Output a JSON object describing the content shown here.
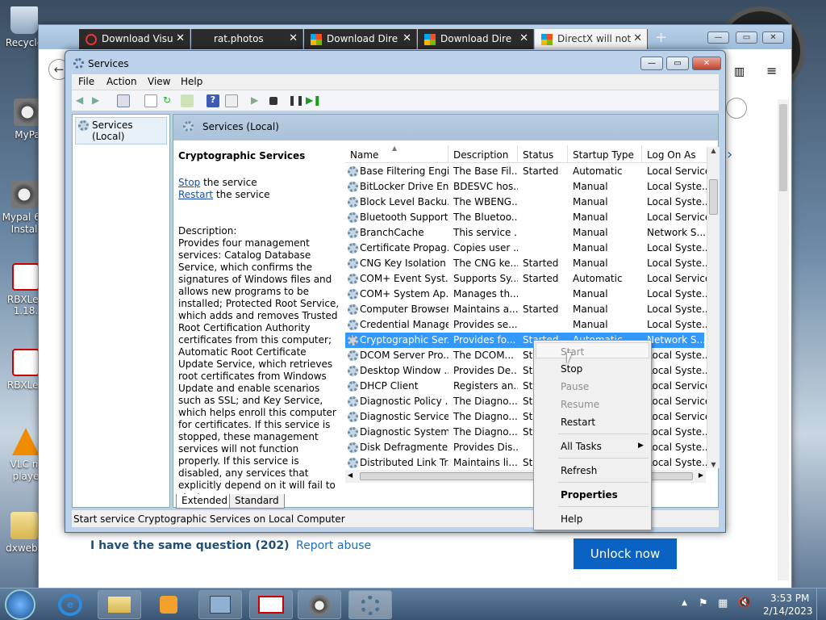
{
  "desktop": {
    "icons": [
      {
        "label": "Recycle"
      },
      {
        "label": "MyPa"
      },
      {
        "label": "Mypal 68 Instal"
      },
      {
        "label": "RBXLeg 1.18."
      },
      {
        "label": "RBXLeg"
      },
      {
        "label": "VLC m playe"
      },
      {
        "label": "dxwebs"
      }
    ]
  },
  "browser": {
    "tabs": [
      {
        "label": "Download Visu",
        "icon": "power-icon"
      },
      {
        "label": "rat.photos",
        "icon": "page-icon"
      },
      {
        "label": "Download Dire",
        "icon": "windows-icon"
      },
      {
        "label": "Download Dire",
        "icon": "windows-icon"
      },
      {
        "label": "DirectX will not",
        "icon": "windows-icon",
        "active": true
      }
    ],
    "new_tab": "+",
    "page": {
      "same_question": "I have the same question (202)",
      "report_abuse": "Report abuse",
      "unlock_now": "Unlock now"
    }
  },
  "services_window": {
    "title": "Services",
    "menu": [
      "File",
      "Action",
      "View",
      "Help"
    ],
    "tree_item": "Services (Local)",
    "header_title": "Services (Local)",
    "selected_service": {
      "name": "Cryptographic Services",
      "stop_link": "Stop",
      "stop_suffix": " the service",
      "restart_link": "Restart",
      "restart_suffix": " the service",
      "description_label": "Description:",
      "description": "Provides four management services: Catalog Database Service, which confirms the signatures of Windows files and allows new programs to be installed; Protected Root Service, which adds and removes Trusted Root Certification Authority certificates from this computer; Automatic Root Certificate Update Service, which retrieves root certificates from Windows Update and enable scenarios such as SSL; and Key Service, which helps enroll this computer for certificates. If this service is stopped, these management services will not function properly. If this service is disabled, any services that explicitly depend on it will fail to start."
    },
    "columns": [
      "Name",
      "Description",
      "Status",
      "Startup Type",
      "Log On As"
    ],
    "rows": [
      [
        "Base Filtering Engi...",
        "The Base Fil...",
        "Started",
        "Automatic",
        "Local Service"
      ],
      [
        "BitLocker Drive En...",
        "BDESVC hos...",
        "",
        "Manual",
        "Local Syste..."
      ],
      [
        "Block Level Backu...",
        "The WBENG...",
        "",
        "Manual",
        "Local Syste..."
      ],
      [
        "Bluetooth Support...",
        "The Bluetoo...",
        "",
        "Manual",
        "Local Service"
      ],
      [
        "BranchCache",
        "This service ...",
        "",
        "Manual",
        "Network S..."
      ],
      [
        "Certificate Propag...",
        "Copies user ...",
        "",
        "Manual",
        "Local Syste..."
      ],
      [
        "CNG Key Isolation",
        "The CNG ke...",
        "Started",
        "Manual",
        "Local Syste..."
      ],
      [
        "COM+ Event Syst...",
        "Supports Sy...",
        "Started",
        "Automatic",
        "Local Service"
      ],
      [
        "COM+ System Ap...",
        "Manages th...",
        "",
        "Manual",
        "Local Syste..."
      ],
      [
        "Computer Browser",
        "Maintains a...",
        "Started",
        "Manual",
        "Local Syste..."
      ],
      [
        "Credential Manager",
        "Provides se...",
        "",
        "Manual",
        "Local Syste..."
      ],
      [
        "Cryptographic Ser...",
        "Provides fo...",
        "Started",
        "Automatic",
        "Network S..."
      ],
      [
        "DCOM Server Pro...",
        "The DCOM...",
        "Sta",
        "",
        "Local Syste..."
      ],
      [
        "Desktop Window ...",
        "Provides De...",
        "Sta",
        "",
        "Local Syste..."
      ],
      [
        "DHCP Client",
        "Registers an...",
        "Sta",
        "",
        "Local Service"
      ],
      [
        "Diagnostic Policy ...",
        "The Diagno...",
        "Sta",
        "",
        "Local Service"
      ],
      [
        "Diagnostic Service...",
        "The Diagno...",
        "Sta",
        "",
        "Local Service"
      ],
      [
        "Diagnostic System...",
        "The Diagno...",
        "Sta",
        "",
        "Local Syste..."
      ],
      [
        "Disk Defragmenter",
        "Provides Dis...",
        "",
        "",
        "Local Syste..."
      ],
      [
        "Distributed Link Tr...",
        "Maintains li...",
        "Sta",
        "",
        "Local Syste..."
      ]
    ],
    "selected_row": 11,
    "view_tabs": [
      "Extended",
      "Standard"
    ],
    "status_bar": "Start service Cryptographic Services on Local Computer"
  },
  "context_menu": {
    "items": [
      {
        "label": "Start",
        "disabled": true
      },
      {
        "label": "Stop",
        "disabled": false
      },
      {
        "label": "Pause",
        "disabled": true
      },
      {
        "label": "Resume",
        "disabled": true
      },
      {
        "label": "Restart",
        "disabled": false
      },
      {
        "label": "All Tasks",
        "disabled": false,
        "submenu": true
      },
      {
        "label": "Refresh",
        "disabled": false
      },
      {
        "label": "Properties",
        "disabled": false,
        "bold": true
      },
      {
        "label": "Help",
        "disabled": false
      }
    ]
  },
  "taskbar": {
    "time": "3:53 PM",
    "date": "2/14/2023"
  },
  "colors": {
    "selection": "#3399ff",
    "link": "#1a4fa0",
    "unlock_button": "#0a63c2"
  }
}
